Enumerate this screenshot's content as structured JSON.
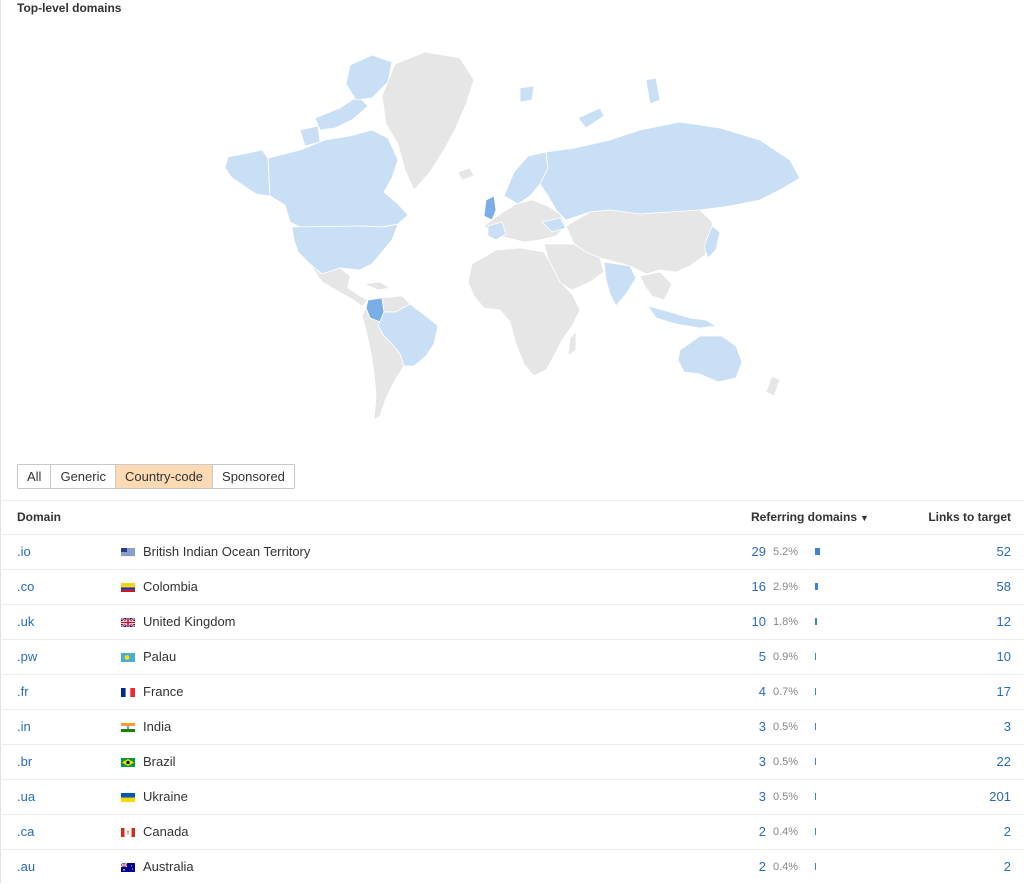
{
  "section_title": "Top-level domains",
  "tabs": [
    {
      "label": "All",
      "active": false
    },
    {
      "label": "Generic",
      "active": false
    },
    {
      "label": "Country-code",
      "active": true
    },
    {
      "label": "Sponsored",
      "active": false
    }
  ],
  "table": {
    "headers": {
      "domain": "Domain",
      "referring": "Referring domains",
      "links": "Links to target"
    },
    "sort_indicator": "▼",
    "rows": [
      {
        "domain": ".io",
        "country": "British Indian Ocean Territory",
        "flag": "io-flag-icon",
        "referring": "29",
        "pct": "5.2%",
        "bar": 0.052,
        "links": "52"
      },
      {
        "domain": ".co",
        "country": "Colombia",
        "flag": "co-flag-icon",
        "referring": "16",
        "pct": "2.9%",
        "bar": 0.029,
        "links": "58"
      },
      {
        "domain": ".uk",
        "country": "United Kingdom",
        "flag": "uk-flag-icon",
        "referring": "10",
        "pct": "1.8%",
        "bar": 0.018,
        "links": "12"
      },
      {
        "domain": ".pw",
        "country": "Palau",
        "flag": "pw-flag-icon",
        "referring": "5",
        "pct": "0.9%",
        "bar": 0.009,
        "links": "10"
      },
      {
        "domain": ".fr",
        "country": "France",
        "flag": "fr-flag-icon",
        "referring": "4",
        "pct": "0.7%",
        "bar": 0.007,
        "links": "17"
      },
      {
        "domain": ".in",
        "country": "India",
        "flag": "in-flag-icon",
        "referring": "3",
        "pct": "0.5%",
        "bar": 0.005,
        "links": "3"
      },
      {
        "domain": ".br",
        "country": "Brazil",
        "flag": "br-flag-icon",
        "referring": "3",
        "pct": "0.5%",
        "bar": 0.005,
        "links": "22"
      },
      {
        "domain": ".ua",
        "country": "Ukraine",
        "flag": "ua-flag-icon",
        "referring": "3",
        "pct": "0.5%",
        "bar": 0.005,
        "links": "201"
      },
      {
        "domain": ".ca",
        "country": "Canada",
        "flag": "ca-flag-icon",
        "referring": "2",
        "pct": "0.4%",
        "bar": 0.004,
        "links": "2"
      },
      {
        "domain": ".au",
        "country": "Australia",
        "flag": "au-flag-icon",
        "referring": "2",
        "pct": "0.4%",
        "bar": 0.004,
        "links": "2"
      }
    ]
  },
  "colors": {
    "highlight": "#c9dff5",
    "strong": "#7aaee6",
    "neutral": "#e6e6e6",
    "border": "#ffffff",
    "active_tab": "#fdd9b4",
    "link": "#2a6bbf",
    "bar": "#3d83d4"
  }
}
